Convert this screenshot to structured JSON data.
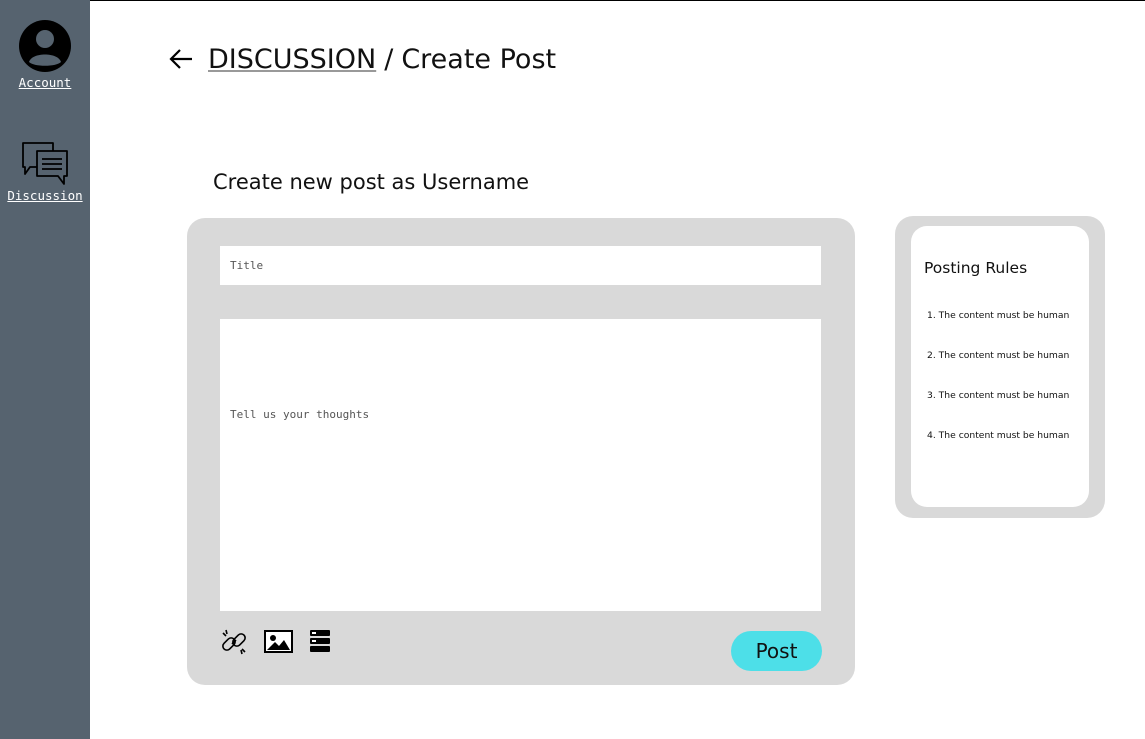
{
  "sidebar": {
    "items": [
      {
        "label": "Account",
        "icon": "account-circle-icon"
      },
      {
        "label": "Discussion",
        "icon": "chat-bubbles-icon"
      }
    ],
    "background": "#56636f"
  },
  "breadcrumb": {
    "back_icon": "arrow-left-icon",
    "parent": "DISCUSSION",
    "separator": "/",
    "current": "Create Post"
  },
  "heading": "Create new post as Username",
  "form": {
    "title_placeholder": "Title",
    "body_placeholder": "Tell us your thoughts",
    "toolbar": [
      "link-icon",
      "image-icon",
      "format-icon"
    ],
    "post_label": "Post",
    "post_color": "#4ddfe8"
  },
  "rules": {
    "title": "Posting Rules",
    "items": [
      "1. The content must be human",
      "2. The content must be human",
      "3. The content must be human",
      "4. The content must be human"
    ]
  }
}
